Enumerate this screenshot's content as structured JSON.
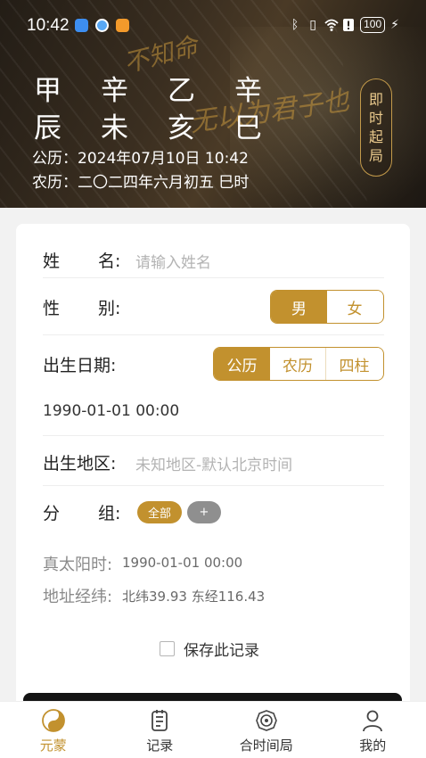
{
  "status": {
    "time": "10:42",
    "battery": "100"
  },
  "header": {
    "pillars_top": [
      "甲",
      "辛",
      "乙",
      "辛"
    ],
    "pillars_bottom": [
      "辰",
      "未",
      "亥",
      "巳"
    ],
    "solar": "公历：2024年07月10日 10:42",
    "lunar": "农历：二〇二四年六月初五 巳时",
    "instant_button": [
      "即",
      "时",
      "起",
      "局"
    ],
    "calligraphy": [
      "不知命",
      "无以为君子也"
    ]
  },
  "form": {
    "name_label": "姓      名:",
    "name_placeholder": "请输入姓名",
    "gender_label": "性      别:",
    "gender_options": [
      "男",
      "女"
    ],
    "gender_selected": "男",
    "birth_label": "出生日期:",
    "calendar_options": [
      "公历",
      "农历",
      "四柱"
    ],
    "calendar_selected": "公历",
    "birth_value": "1990-01-01 00:00",
    "region_label": "出生地区:",
    "region_placeholder": "未知地区-默认北京时间",
    "group_label": "分      组:",
    "group_all": "全部",
    "group_add": "+",
    "true_solar_label": "真太阳时:",
    "true_solar_value": "1990-01-01 00:00",
    "coords_label": "地址经纬:",
    "coords_value": "北纬39.93 东经116.43",
    "save_label": "保存此记录"
  },
  "nav": [
    {
      "label": "元蒙",
      "icon": "yinyang-icon",
      "active": true
    },
    {
      "label": "记录",
      "icon": "record-icon",
      "active": false
    },
    {
      "label": "合时间局",
      "icon": "compass-icon",
      "active": false
    },
    {
      "label": "我的",
      "icon": "user-icon",
      "active": false
    }
  ],
  "colors": {
    "accent": "#c2912e",
    "header_bg": "#2e251a"
  }
}
